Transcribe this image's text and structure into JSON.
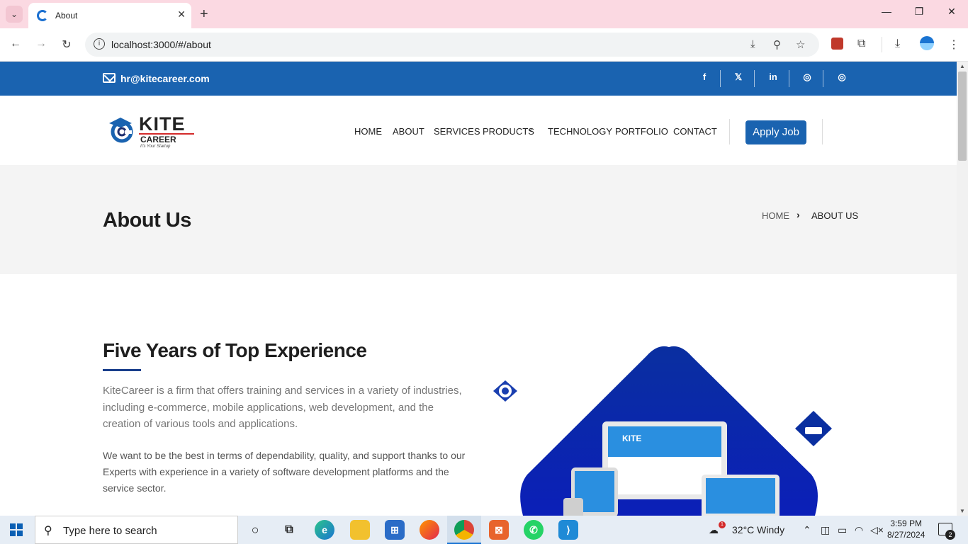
{
  "browser": {
    "tab_title": "About",
    "url": "localhost:3000/#/about"
  },
  "topbar": {
    "email": "hr@kitecareer.com",
    "socials": [
      "f",
      "𝕏",
      "in",
      "◎",
      "◎"
    ]
  },
  "logo": {
    "main": "KITE",
    "sub": "CAREER",
    "tagline": "It's Your Startup"
  },
  "nav": {
    "items": [
      "HOME",
      "ABOUT",
      "SERVICES",
      "PRODUCTS",
      "TECHNOLOGY",
      "PORTFOLIO",
      "CONTACT"
    ],
    "apply_label": "Apply Job"
  },
  "page": {
    "title": "About Us",
    "breadcrumb": {
      "home": "HOME",
      "current": "ABOUT US"
    }
  },
  "content": {
    "heading": "Five Years of Top Experience",
    "para1": "KiteCareer is a firm that offers training and services in a variety of industries, including e-commerce, mobile applications, web development, and the creation of various tools and applications.",
    "para2": "We want to be the best in terms of dependability, quality, and support thanks to our Experts with experience in a variety of software development platforms and the service sector."
  },
  "taskbar": {
    "search_placeholder": "Type here to search",
    "weather": "32°C  Windy",
    "time": "3:59 PM",
    "date": "8/27/2024",
    "notification_count": "2",
    "weather_badge": "1"
  }
}
